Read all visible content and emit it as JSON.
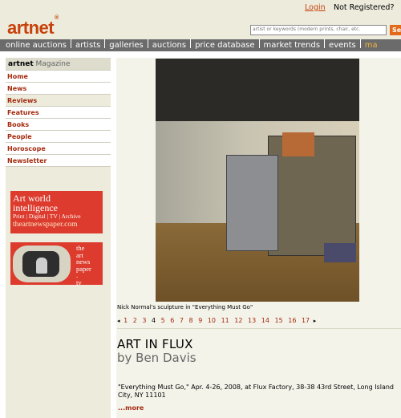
{
  "header": {
    "logo": "artnet",
    "logo_mark": "®",
    "login": "Login",
    "not_registered": "Not Registered?",
    "search_placeholder": "artist or keywords (modern prints, chair, etc.",
    "search_button": "Se"
  },
  "nav": {
    "items": [
      "online auctions",
      "artists",
      "galleries",
      "auctions",
      "price database",
      "market trends",
      "events",
      "ma"
    ]
  },
  "sidebar": {
    "brand": "artnet",
    "magazine": "Magazine",
    "items": [
      "Home",
      "News",
      "Reviews",
      "Features",
      "Books",
      "People",
      "Horoscope",
      "Newsletter"
    ]
  },
  "ads": {
    "newspaper": {
      "line1": "Art world",
      "line2": "intelligence",
      "line3": "Print | Digital | TV | Archive",
      "line4": "theartnewspaper.com"
    },
    "tv": {
      "line1": "the",
      "line2": "art",
      "line3": "news",
      "line4": "paper",
      "line5": ".",
      "line6": "tv"
    }
  },
  "main": {
    "caption": "Nick Normal's sculpture in \"Everything Must Go\"",
    "pager": {
      "prev": "◂",
      "next": "▸",
      "pages": [
        "1",
        "2",
        "3",
        "4",
        "5",
        "6",
        "7",
        "8",
        "9",
        "10",
        "11",
        "12",
        "13",
        "14",
        "15",
        "16",
        "17"
      ],
      "current": "4"
    },
    "title": "ART IN FLUX",
    "author": "by Ben Davis",
    "info": "\"Everything Must Go,\" Apr. 4-26, 2008, at Flux Factory, 38-38 43rd Street, Long Island City, NY 11101",
    "more": "...more"
  },
  "colors": {
    "brand": "#c8410b",
    "nav_bg": "#6b6b6b",
    "sidebar_bg": "#ecebdc",
    "link": "#a32a0e",
    "ad_red": "#dc3b2d"
  }
}
